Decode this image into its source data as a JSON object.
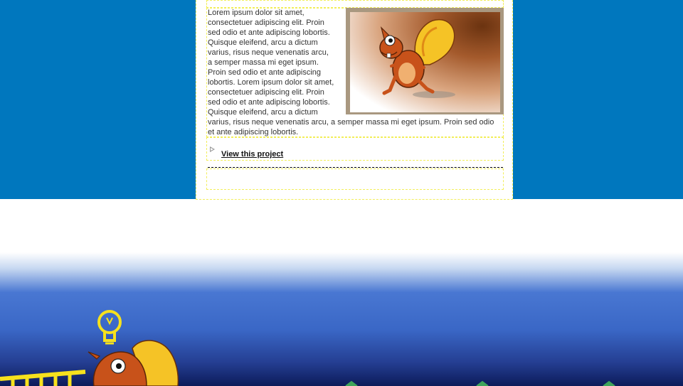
{
  "article": {
    "text_wrapped": "Lorem ipsum dolor sit amet, consectetuer adipiscing elit. Proin sed odio et ante adipiscing lobortis. Quisque eleifend, arcu a dictum varius, risus neque venenatis arcu, a semper massa mi eget ipsum. Proin sed odio et ante adipiscing lobortis. Lorem ipsum dolor sit amet, consectetuer adipiscing elit. Proin sed odio et ante adipiscing lobortis. Quisque eleifend, arcu a dictum",
    "text_full": "varius, risus neque venenatis arcu, a semper massa mi eget ipsum. Proin sed odio et ante adipiscing lobortis.",
    "link_label": "View this project"
  },
  "colors": {
    "top_band": "#0077be",
    "guide_dash": "#f2ee5a",
    "photo_frame": "#a99880",
    "squirrel_fur": "#c8521a",
    "squirrel_tail": "#f5c326",
    "lightbulb": "#f6e11d",
    "bottom_band_dark": "#0c1b5a"
  },
  "icons": {
    "link_arrow": "triangle-right-outline-icon",
    "photo": "squirrel-illustration",
    "bulb": "lightbulb-icon",
    "ladder": "ladder-icon"
  }
}
